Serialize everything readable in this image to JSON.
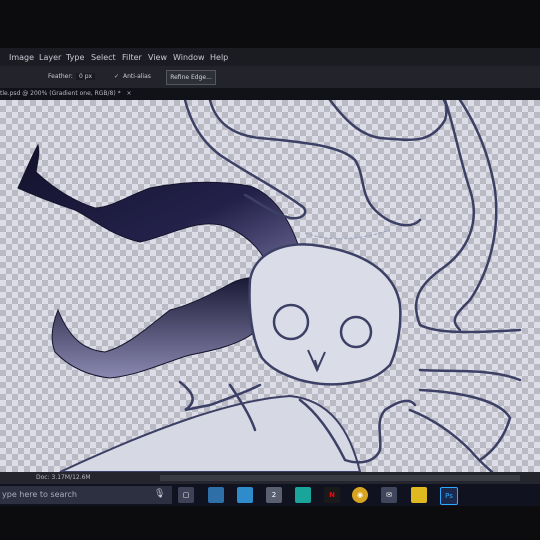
{
  "menu": {
    "items": [
      {
        "label": "Image"
      },
      {
        "label": "Layer"
      },
      {
        "label": "Type"
      },
      {
        "label": "Select"
      },
      {
        "label": "Filter"
      },
      {
        "label": "View"
      },
      {
        "label": "Window"
      },
      {
        "label": "Help"
      }
    ]
  },
  "options": {
    "feather_label": "Feather:",
    "feather_value": "0 px",
    "antialias_label": "Anti-alias",
    "antialias_checked": true,
    "refine_edge_label": "Refine Edge..."
  },
  "document": {
    "tab_title": "tle.psd @ 200% (Gradient one, RGB/8) *",
    "close_glyph": "×",
    "status_text": "Doc: 3.17M/12.6M"
  },
  "taskbar": {
    "search_placeholder": "ype here to search",
    "mic_icon": "microphone-icon",
    "apps": [
      {
        "name": "task-view-icon",
        "color": "#3d4256",
        "glyph": "▢"
      },
      {
        "name": "file-explorer-icon",
        "color": "#2f6fa8",
        "glyph": ""
      },
      {
        "name": "store-icon",
        "color": "#2d8cc9",
        "glyph": ""
      },
      {
        "name": "windowed-app-icon",
        "color": "#5a6070",
        "glyph": "2"
      },
      {
        "name": "teal-app-icon",
        "color": "#1aa59b",
        "glyph": ""
      },
      {
        "name": "netflix-icon",
        "color": "#1a1a1a",
        "glyph": "N"
      },
      {
        "name": "chrome-icon",
        "color": "#d7a421",
        "glyph": "◉"
      },
      {
        "name": "mail-icon",
        "color": "#40475c",
        "glyph": "✉"
      },
      {
        "name": "yellow-app-icon",
        "color": "#e0b820",
        "glyph": ""
      },
      {
        "name": "photoshop-icon",
        "color": "#1b2a4c",
        "glyph": "Ps"
      }
    ]
  },
  "colors": {
    "horn_dark": "#1e1c38",
    "line": "#3d4065",
    "ps_accent": "#31a8ff"
  }
}
